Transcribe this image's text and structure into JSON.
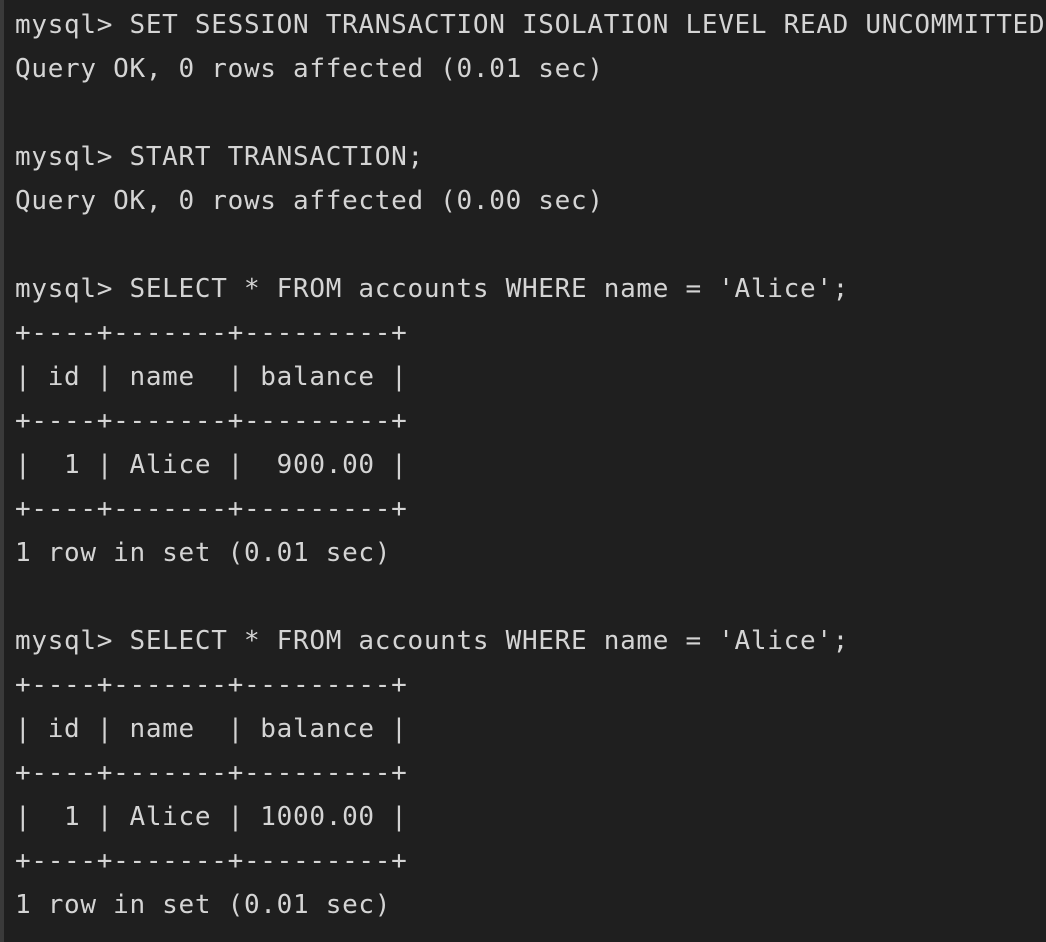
{
  "terminal": {
    "lines": [
      "mysql> SET SESSION TRANSACTION ISOLATION LEVEL READ UNCOMMITTED;",
      "Query OK, 0 rows affected (0.01 sec)",
      "",
      "mysql> START TRANSACTION;",
      "Query OK, 0 rows affected (0.00 sec)",
      "",
      "mysql> SELECT * FROM accounts WHERE name = 'Alice';",
      "+----+-------+---------+",
      "| id | name  | balance |",
      "+----+-------+---------+",
      "|  1 | Alice |  900.00 |",
      "+----+-------+---------+",
      "1 row in set (0.01 sec)",
      "",
      "mysql> SELECT * FROM accounts WHERE name = 'Alice';",
      "+----+-------+---------+",
      "| id | name  | balance |",
      "+----+-------+---------+",
      "|  1 | Alice | 1000.00 |",
      "+----+-------+---------+",
      "1 row in set (0.01 sec)"
    ]
  }
}
